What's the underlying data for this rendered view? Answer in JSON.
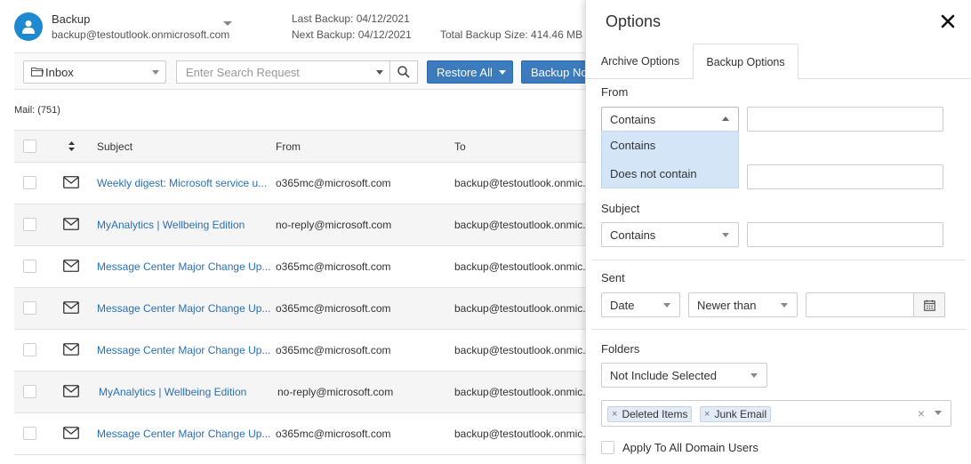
{
  "account": {
    "name": "Backup",
    "email": "backup@testoutlook.onmicrosoft.com",
    "last_backup": "Last Backup: 04/12/2021",
    "next_backup": "Next Backup: 04/12/2021",
    "total_size": "Total Backup Size: 414.46 MB"
  },
  "toolbar": {
    "folder": "Inbox",
    "search_placeholder": "Enter Search Request",
    "restore_all": "Restore All",
    "backup_now": "Backup No"
  },
  "mail_count": "Mail: (751)",
  "grid": {
    "columns": {
      "subject": "Subject",
      "from": "From",
      "to": "To"
    },
    "rows": [
      {
        "subject": "Weekly digest: Microsoft service u...",
        "from": "o365mc@microsoft.com",
        "to": "backup@testoutlook.onmic..."
      },
      {
        "subject": "MyAnalytics | Wellbeing Edition",
        "from": "no-reply@microsoft.com",
        "to": "backup@testoutlook.onmic..."
      },
      {
        "subject": "Message Center Major Change Up...",
        "from": "o365mc@microsoft.com",
        "to": "backup@testoutlook.onmic..."
      },
      {
        "subject": "Message Center Major Change Up...",
        "from": "o365mc@microsoft.com",
        "to": "backup@testoutlook.onmic..."
      },
      {
        "subject": "Message Center Major Change Up...",
        "from": "o365mc@microsoft.com",
        "to": "backup@testoutlook.onmic..."
      },
      {
        "subject": "MyAnalytics | Wellbeing Edition",
        "from": "no-reply@microsoft.com",
        "to": "backup@testoutlook.onmic..."
      },
      {
        "subject": "Message Center Major Change Up...",
        "from": "o365mc@microsoft.com",
        "to": "backup@testoutlook.onmic..."
      }
    ]
  },
  "options": {
    "title": "Options",
    "tabs": [
      "Archive Options",
      "Backup Options"
    ],
    "active_tab": "Backup Options",
    "from": {
      "label": "From",
      "condition": "Contains",
      "value": "",
      "dropdown_options": [
        "Contains",
        "Does not contain"
      ]
    },
    "subject": {
      "label": "Subject",
      "condition": "Contains",
      "value": ""
    },
    "sent": {
      "label": "Sent",
      "type": "Date",
      "condition": "Newer than",
      "value": ""
    },
    "folders": {
      "label": "Folders",
      "mode": "Not Include Selected",
      "selected": [
        "Deleted Items",
        "Junk Email"
      ]
    },
    "apply_all": "Apply To All Domain Users"
  },
  "colors": {
    "accent": "#3c7bbd",
    "avatar": "#1e88d0",
    "link": "#2a70b8",
    "dropdown_highlight": "#d4e5f7"
  }
}
